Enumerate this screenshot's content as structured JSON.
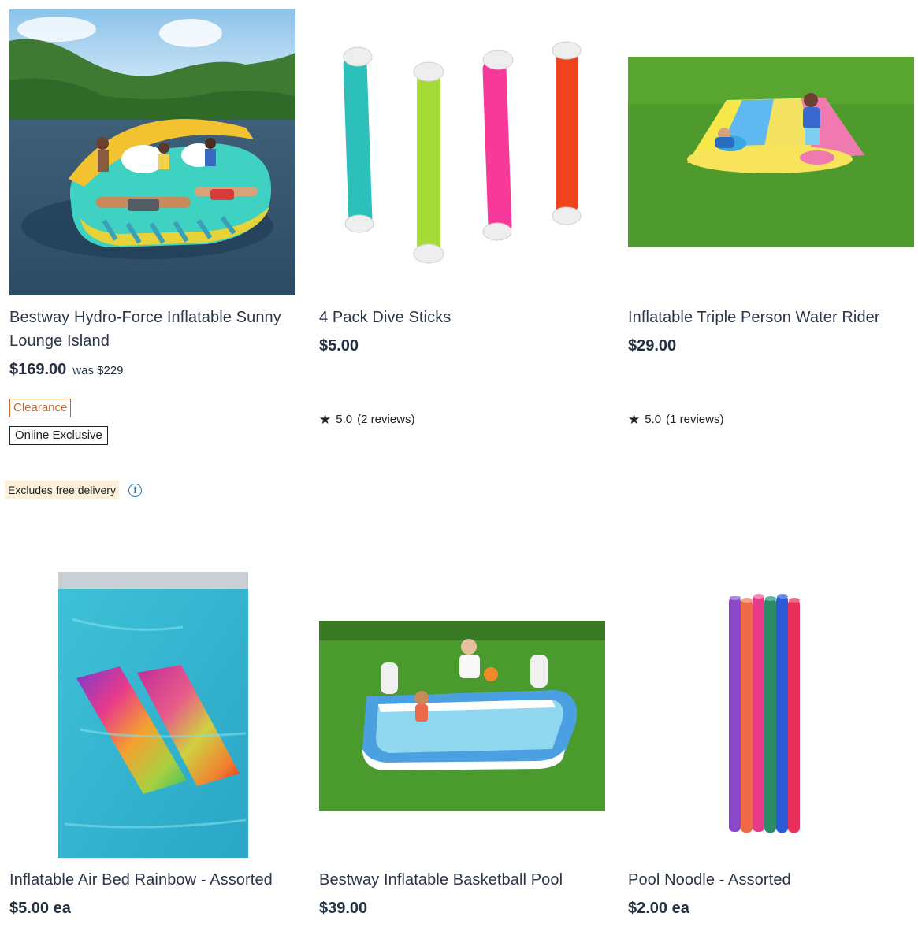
{
  "products": [
    {
      "title": "Bestway Hydro-Force Inflatable Sunny Lounge Island",
      "price": "$169.00",
      "was": "was $229",
      "badges": [
        "Clearance",
        "Online Exclusive"
      ],
      "notice": "Excludes free delivery",
      "image_icon": "inflatable-island-image"
    },
    {
      "title": "4 Pack Dive Sticks",
      "price": "$5.00",
      "rating": "5.0",
      "reviews": "(2 reviews)",
      "image_icon": "dive-sticks-image"
    },
    {
      "title": "Inflatable Triple Person Water Rider",
      "price": "$29.00",
      "rating": "5.0",
      "reviews": "(1 reviews)",
      "image_icon": "water-slide-image"
    },
    {
      "title": "Inflatable Air Bed Rainbow - Assorted",
      "price": "$5.00",
      "unit": "ea",
      "image_icon": "air-bed-image"
    },
    {
      "title": "Bestway Inflatable Basketball Pool",
      "price": "$39.00",
      "image_icon": "basketball-pool-image"
    },
    {
      "title": "Pool Noodle - Assorted",
      "price": "$2.00",
      "unit": "ea",
      "image_icon": "pool-noodles-image"
    }
  ],
  "colors": {
    "clearance": "#c8682a",
    "notice_bg": "#fdf0d8",
    "info_icon": "#2a7ab8",
    "text": "#243043"
  }
}
